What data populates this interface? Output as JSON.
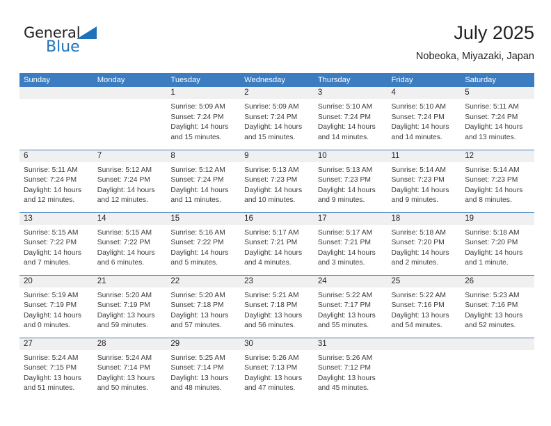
{
  "brand": {
    "name_part1": "General",
    "name_part2": "Blue",
    "triangle_color": "#1e72bb",
    "text_color": "#231f20"
  },
  "header": {
    "title": "July 2025",
    "subtitle": "Nobeoka, Miyazaki, Japan"
  },
  "theme": {
    "header_blue": "#3b7dc0",
    "daynum_gray": "#f0f0f0",
    "text": "#231f20"
  },
  "weekday_headers": [
    "Sunday",
    "Monday",
    "Tuesday",
    "Wednesday",
    "Thursday",
    "Friday",
    "Saturday"
  ],
  "weeks": [
    [
      {
        "day": "",
        "sunrise": "",
        "sunset": "",
        "daylight1": "",
        "daylight2": ""
      },
      {
        "day": "",
        "sunrise": "",
        "sunset": "",
        "daylight1": "",
        "daylight2": ""
      },
      {
        "day": "1",
        "sunrise": "Sunrise: 5:09 AM",
        "sunset": "Sunset: 7:24 PM",
        "daylight1": "Daylight: 14 hours",
        "daylight2": "and 15 minutes."
      },
      {
        "day": "2",
        "sunrise": "Sunrise: 5:09 AM",
        "sunset": "Sunset: 7:24 PM",
        "daylight1": "Daylight: 14 hours",
        "daylight2": "and 15 minutes."
      },
      {
        "day": "3",
        "sunrise": "Sunrise: 5:10 AM",
        "sunset": "Sunset: 7:24 PM",
        "daylight1": "Daylight: 14 hours",
        "daylight2": "and 14 minutes."
      },
      {
        "day": "4",
        "sunrise": "Sunrise: 5:10 AM",
        "sunset": "Sunset: 7:24 PM",
        "daylight1": "Daylight: 14 hours",
        "daylight2": "and 14 minutes."
      },
      {
        "day": "5",
        "sunrise": "Sunrise: 5:11 AM",
        "sunset": "Sunset: 7:24 PM",
        "daylight1": "Daylight: 14 hours",
        "daylight2": "and 13 minutes."
      }
    ],
    [
      {
        "day": "6",
        "sunrise": "Sunrise: 5:11 AM",
        "sunset": "Sunset: 7:24 PM",
        "daylight1": "Daylight: 14 hours",
        "daylight2": "and 12 minutes."
      },
      {
        "day": "7",
        "sunrise": "Sunrise: 5:12 AM",
        "sunset": "Sunset: 7:24 PM",
        "daylight1": "Daylight: 14 hours",
        "daylight2": "and 12 minutes."
      },
      {
        "day": "8",
        "sunrise": "Sunrise: 5:12 AM",
        "sunset": "Sunset: 7:24 PM",
        "daylight1": "Daylight: 14 hours",
        "daylight2": "and 11 minutes."
      },
      {
        "day": "9",
        "sunrise": "Sunrise: 5:13 AM",
        "sunset": "Sunset: 7:23 PM",
        "daylight1": "Daylight: 14 hours",
        "daylight2": "and 10 minutes."
      },
      {
        "day": "10",
        "sunrise": "Sunrise: 5:13 AM",
        "sunset": "Sunset: 7:23 PM",
        "daylight1": "Daylight: 14 hours",
        "daylight2": "and 9 minutes."
      },
      {
        "day": "11",
        "sunrise": "Sunrise: 5:14 AM",
        "sunset": "Sunset: 7:23 PM",
        "daylight1": "Daylight: 14 hours",
        "daylight2": "and 9 minutes."
      },
      {
        "day": "12",
        "sunrise": "Sunrise: 5:14 AM",
        "sunset": "Sunset: 7:23 PM",
        "daylight1": "Daylight: 14 hours",
        "daylight2": "and 8 minutes."
      }
    ],
    [
      {
        "day": "13",
        "sunrise": "Sunrise: 5:15 AM",
        "sunset": "Sunset: 7:22 PM",
        "daylight1": "Daylight: 14 hours",
        "daylight2": "and 7 minutes."
      },
      {
        "day": "14",
        "sunrise": "Sunrise: 5:15 AM",
        "sunset": "Sunset: 7:22 PM",
        "daylight1": "Daylight: 14 hours",
        "daylight2": "and 6 minutes."
      },
      {
        "day": "15",
        "sunrise": "Sunrise: 5:16 AM",
        "sunset": "Sunset: 7:22 PM",
        "daylight1": "Daylight: 14 hours",
        "daylight2": "and 5 minutes."
      },
      {
        "day": "16",
        "sunrise": "Sunrise: 5:17 AM",
        "sunset": "Sunset: 7:21 PM",
        "daylight1": "Daylight: 14 hours",
        "daylight2": "and 4 minutes."
      },
      {
        "day": "17",
        "sunrise": "Sunrise: 5:17 AM",
        "sunset": "Sunset: 7:21 PM",
        "daylight1": "Daylight: 14 hours",
        "daylight2": "and 3 minutes."
      },
      {
        "day": "18",
        "sunrise": "Sunrise: 5:18 AM",
        "sunset": "Sunset: 7:20 PM",
        "daylight1": "Daylight: 14 hours",
        "daylight2": "and 2 minutes."
      },
      {
        "day": "19",
        "sunrise": "Sunrise: 5:18 AM",
        "sunset": "Sunset: 7:20 PM",
        "daylight1": "Daylight: 14 hours",
        "daylight2": "and 1 minute."
      }
    ],
    [
      {
        "day": "20",
        "sunrise": "Sunrise: 5:19 AM",
        "sunset": "Sunset: 7:19 PM",
        "daylight1": "Daylight: 14 hours",
        "daylight2": "and 0 minutes."
      },
      {
        "day": "21",
        "sunrise": "Sunrise: 5:20 AM",
        "sunset": "Sunset: 7:19 PM",
        "daylight1": "Daylight: 13 hours",
        "daylight2": "and 59 minutes."
      },
      {
        "day": "22",
        "sunrise": "Sunrise: 5:20 AM",
        "sunset": "Sunset: 7:18 PM",
        "daylight1": "Daylight: 13 hours",
        "daylight2": "and 57 minutes."
      },
      {
        "day": "23",
        "sunrise": "Sunrise: 5:21 AM",
        "sunset": "Sunset: 7:18 PM",
        "daylight1": "Daylight: 13 hours",
        "daylight2": "and 56 minutes."
      },
      {
        "day": "24",
        "sunrise": "Sunrise: 5:22 AM",
        "sunset": "Sunset: 7:17 PM",
        "daylight1": "Daylight: 13 hours",
        "daylight2": "and 55 minutes."
      },
      {
        "day": "25",
        "sunrise": "Sunrise: 5:22 AM",
        "sunset": "Sunset: 7:16 PM",
        "daylight1": "Daylight: 13 hours",
        "daylight2": "and 54 minutes."
      },
      {
        "day": "26",
        "sunrise": "Sunrise: 5:23 AM",
        "sunset": "Sunset: 7:16 PM",
        "daylight1": "Daylight: 13 hours",
        "daylight2": "and 52 minutes."
      }
    ],
    [
      {
        "day": "27",
        "sunrise": "Sunrise: 5:24 AM",
        "sunset": "Sunset: 7:15 PM",
        "daylight1": "Daylight: 13 hours",
        "daylight2": "and 51 minutes."
      },
      {
        "day": "28",
        "sunrise": "Sunrise: 5:24 AM",
        "sunset": "Sunset: 7:14 PM",
        "daylight1": "Daylight: 13 hours",
        "daylight2": "and 50 minutes."
      },
      {
        "day": "29",
        "sunrise": "Sunrise: 5:25 AM",
        "sunset": "Sunset: 7:14 PM",
        "daylight1": "Daylight: 13 hours",
        "daylight2": "and 48 minutes."
      },
      {
        "day": "30",
        "sunrise": "Sunrise: 5:26 AM",
        "sunset": "Sunset: 7:13 PM",
        "daylight1": "Daylight: 13 hours",
        "daylight2": "and 47 minutes."
      },
      {
        "day": "31",
        "sunrise": "Sunrise: 5:26 AM",
        "sunset": "Sunset: 7:12 PM",
        "daylight1": "Daylight: 13 hours",
        "daylight2": "and 45 minutes."
      },
      {
        "day": "",
        "sunrise": "",
        "sunset": "",
        "daylight1": "",
        "daylight2": ""
      },
      {
        "day": "",
        "sunrise": "",
        "sunset": "",
        "daylight1": "",
        "daylight2": ""
      }
    ]
  ]
}
